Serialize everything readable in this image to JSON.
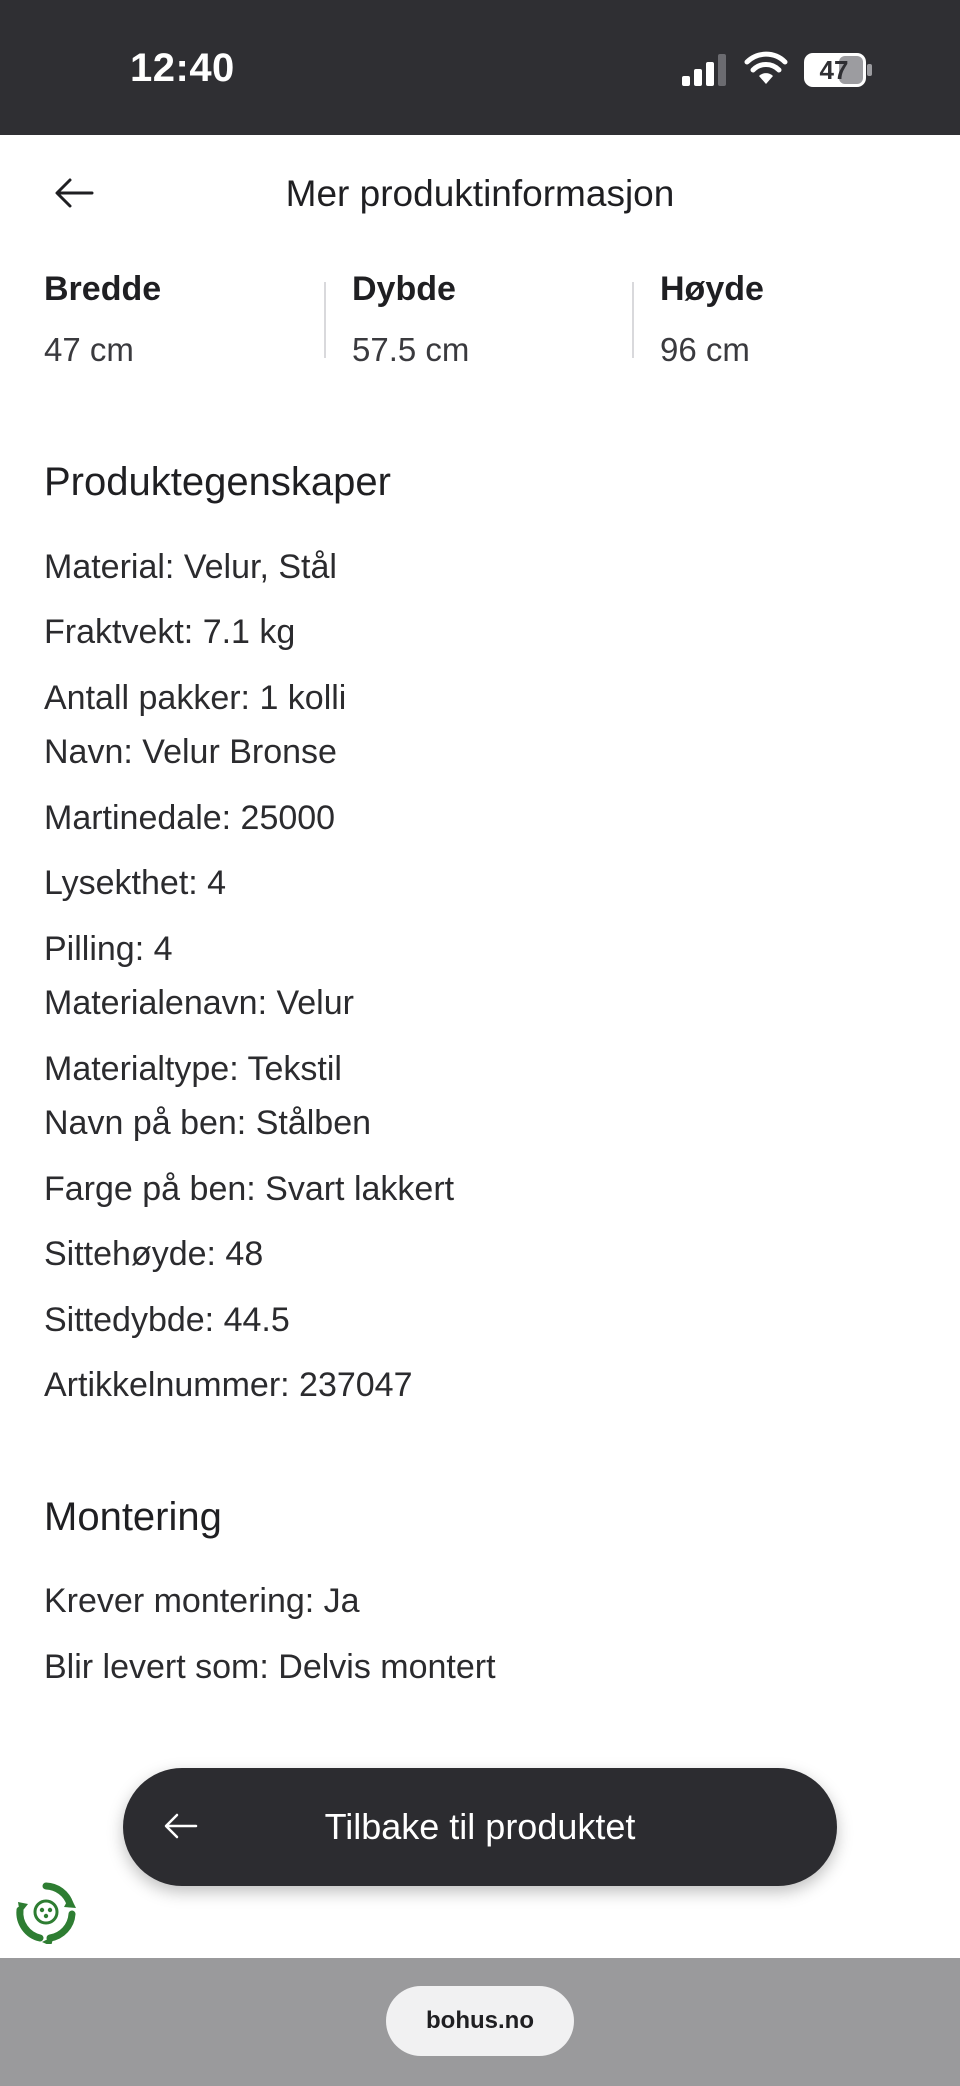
{
  "status_bar": {
    "time": "12:40",
    "battery": "47"
  },
  "header": {
    "title": "Mer produktinformasjon",
    "back_icon": "arrow-left-icon"
  },
  "dimensions": [
    {
      "label": "Bredde",
      "value": "47 cm"
    },
    {
      "label": "Dybde",
      "value": "57.5 cm"
    },
    {
      "label": "Høyde",
      "value": "96 cm"
    }
  ],
  "properties": {
    "title": "Produktegenskaper",
    "items": [
      "Material: Velur, Stål",
      "Fraktvekt: 7.1 kg",
      "Antall pakker: 1 kolli",
      "Navn: Velur Bronse",
      "Martinedale: 25000",
      "Lysekthet: 4",
      "Pilling: 4",
      "Materialenavn: Velur",
      "Materialtype: Tekstil",
      "Navn på ben: Stålben",
      "Farge på ben: Svart lakkert",
      "Sittehøyde: 48",
      "Sittedybde: 44.5",
      "Artikkelnummer: 237047"
    ]
  },
  "assembly": {
    "title": "Montering",
    "items": [
      "Krever montering: Ja",
      "Blir levert som: Delvis montert"
    ]
  },
  "cta": {
    "label": "Tilbake til produktet",
    "icon": "arrow-left-icon"
  },
  "floating_icon": "recycle-icon",
  "browser": {
    "url": "bohus.no"
  },
  "colors": {
    "dark": "#2c2c30",
    "status_bar": "#2f2f33",
    "browser_bar": "#9a9a9c",
    "recycle_green": "#2e7d32"
  }
}
